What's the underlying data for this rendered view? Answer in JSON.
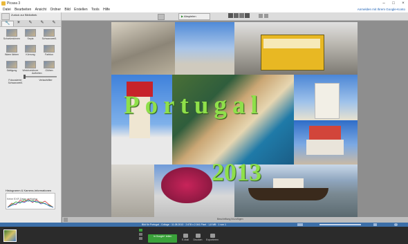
{
  "window": {
    "title": "Picasa 3"
  },
  "menu": {
    "items": [
      "Datei",
      "Bearbeiten",
      "Ansicht",
      "Ordner",
      "Bild",
      "Erstellen",
      "Tools",
      "Hilfe"
    ],
    "signin": "Anmelden mit Ihrem Google-Konto"
  },
  "toolbar": {
    "play_label": "Abspielen"
  },
  "sidebar": {
    "back_label": "Zurück zur Bibliothek",
    "effects": [
      {
        "label": "Scharfzeichnen"
      },
      {
        "label": "Sepia"
      },
      {
        "label": "Schwarzweiß"
      },
      {
        "label": "Warm färben"
      },
      {
        "label": "Körnung"
      },
      {
        "label": "Farbton"
      },
      {
        "label": "Sättigung"
      },
      {
        "label": "Weichzeichner"
      },
      {
        "label": "Glühen"
      },
      {
        "label": "Fokussierter Schwarzweiß"
      },
      {
        "label": "Verlaufsfilter"
      }
    ],
    "slider_label": "Aufhellen",
    "histogram_title": "Histogramm & Kamera-Informationen",
    "histogram_sub": "Keine EXIF-Daten verfügbar"
  },
  "collage": {
    "title_text": "Portugal",
    "year_text": "2013"
  },
  "caption": {
    "text": "Beschriftung hinzufügen"
  },
  "status": {
    "text": "Bild für Portugal - Collage  ·  11.08.2013  ·  2.678 x 2.041 Pixel  ·  1,8 MB  ·  1 von 1"
  },
  "tray": {
    "share_label": "In Google+ teilen",
    "actions": [
      "E-Mail",
      "Drucken",
      "Exportieren"
    ]
  },
  "colors": {
    "accent": "#3c6fa8",
    "share": "#3aa13a",
    "title_green": "#8fe04a"
  }
}
